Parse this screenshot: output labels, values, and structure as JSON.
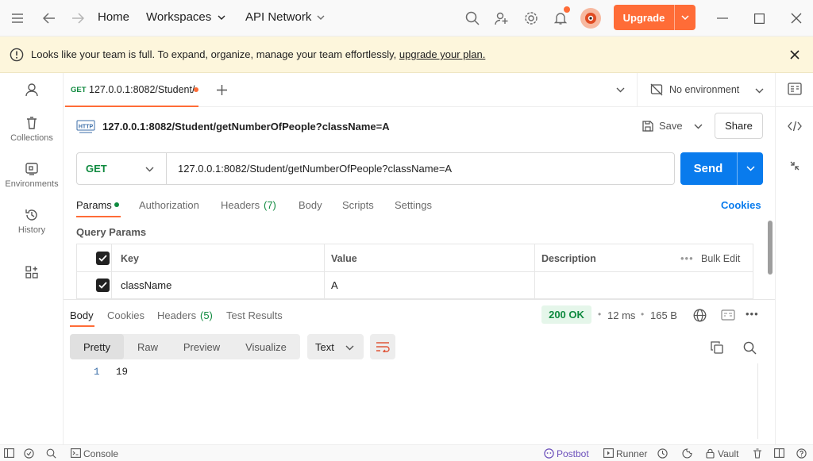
{
  "topbar": {
    "nav_home": "Home",
    "nav_workspaces": "Workspaces",
    "nav_api_network": "API Network",
    "upgrade_label": "Upgrade"
  },
  "banner": {
    "message": "Looks like your team is full. To expand, organize, manage your team effortlessly,",
    "link": "upgrade your plan."
  },
  "sidebar": {
    "items": [
      {
        "label": ""
      },
      {
        "label": "Collections"
      },
      {
        "label": "Environments"
      },
      {
        "label": "History"
      },
      {
        "label": ""
      }
    ]
  },
  "tabs": {
    "method": "GET",
    "title": "127.0.0.1:8082/Student/",
    "environment": "No environment"
  },
  "request": {
    "name": "127.0.0.1:8082/Student/getNumberOfPeople?className=A",
    "save_label": "Save",
    "share_label": "Share",
    "method": "GET",
    "url": "127.0.0.1:8082/Student/getNumberOfPeople?className=A",
    "send_label": "Send",
    "tabs": [
      "Params",
      "Authorization",
      "Headers",
      "(7)",
      "Body",
      "Scripts",
      "Settings"
    ],
    "cookies_label": "Cookies",
    "query_params_title": "Query Params",
    "table": {
      "headers": [
        "Key",
        "Value",
        "Description"
      ],
      "bulk_edit": "Bulk Edit",
      "rows": [
        {
          "key": "className",
          "value": "A",
          "description": ""
        }
      ]
    }
  },
  "response": {
    "tabs": [
      "Body",
      "Cookies",
      "Headers",
      "(5)",
      "Test Results"
    ],
    "status": "200 OK",
    "time": "12 ms",
    "size": "165 B",
    "formats": [
      "Pretty",
      "Raw",
      "Preview",
      "Visualize"
    ],
    "type_select": "Text",
    "line_number": "1",
    "body": "19"
  },
  "statusbar": {
    "console": "Console",
    "postbot": "Postbot",
    "runner": "Runner",
    "vault": "Vault"
  },
  "colors": {
    "accent": "#ff6c37",
    "send_blue": "#097bed",
    "method_green": "#0f8a3f",
    "status_ok_bg": "#e5f6ea"
  }
}
